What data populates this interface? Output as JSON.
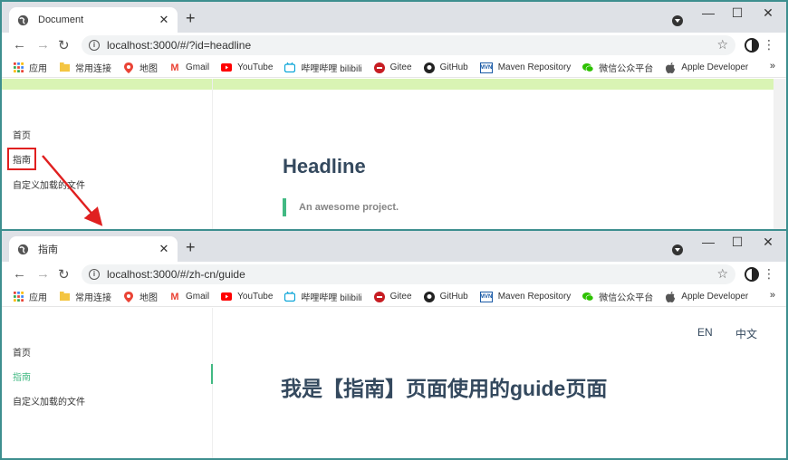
{
  "window1": {
    "tab_title": "Document",
    "url": "localhost:3000/#/?id=headline",
    "sidebar": [
      {
        "label": "首页"
      },
      {
        "label": "指南"
      },
      {
        "label": "自定义加载的文件"
      }
    ],
    "headline": "Headline",
    "quote": "An awesome project."
  },
  "window2": {
    "tab_title": "指南",
    "url": "localhost:3000/#/zh-cn/guide",
    "sidebar": [
      {
        "label": "首页"
      },
      {
        "label": "指南"
      },
      {
        "label": "自定义加载的文件"
      }
    ],
    "lang_en": "EN",
    "lang_zh": "中文",
    "heading": "我是【指南】页面使用的guide页面"
  },
  "bookmarks": [
    {
      "label": "应用",
      "icon": "apps-icon"
    },
    {
      "label": "常用连接",
      "icon": "folder-icon"
    },
    {
      "label": "地图",
      "icon": "maps-icon"
    },
    {
      "label": "Gmail",
      "icon": "gmail-icon"
    },
    {
      "label": "YouTube",
      "icon": "youtube-icon"
    },
    {
      "label": "哔哩哔哩 bilibili",
      "icon": "bilibili-icon"
    },
    {
      "label": "Gitee",
      "icon": "gitee-icon"
    },
    {
      "label": "GitHub",
      "icon": "github-icon"
    },
    {
      "label": "Maven Repository",
      "icon": "maven-icon"
    },
    {
      "label": "微信公众平台",
      "icon": "wechat-icon"
    },
    {
      "label": "Apple Developer",
      "icon": "apple-icon"
    }
  ],
  "bookmarks_more": "»",
  "colors": {
    "accent": "#42b983",
    "heading": "#34495e",
    "highlight": "#e02020",
    "window_border": "#3d8f8f"
  }
}
